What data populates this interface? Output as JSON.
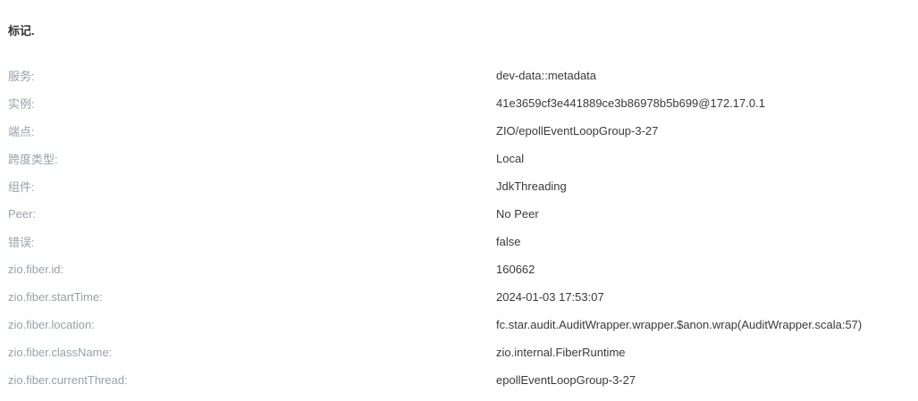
{
  "section": {
    "title": "标记."
  },
  "tags": [
    {
      "key": "服务:",
      "value": "dev-data::metadata"
    },
    {
      "key": "实例:",
      "value": "41e3659cf3e441889ce3b86978b5b699@172.17.0.1"
    },
    {
      "key": "端点:",
      "value": "ZIO/epollEventLoopGroup-3-27"
    },
    {
      "key": "跨度类型:",
      "value": "Local"
    },
    {
      "key": "组件:",
      "value": "JdkThreading"
    },
    {
      "key": "Peer:",
      "value": "No Peer"
    },
    {
      "key": "错误:",
      "value": "false"
    },
    {
      "key": "zio.fiber.id:",
      "value": "160662"
    },
    {
      "key": "zio.fiber.startTime:",
      "value": "2024-01-03 17:53:07"
    },
    {
      "key": "zio.fiber.location:",
      "value": "fc.star.audit.AuditWrapper.wrapper.$anon.wrap(AuditWrapper.scala:57)"
    },
    {
      "key": "zio.fiber.className:",
      "value": "zio.internal.FiberRuntime"
    },
    {
      "key": "zio.fiber.currentThread:",
      "value": "epollEventLoopGroup-3-27"
    }
  ]
}
